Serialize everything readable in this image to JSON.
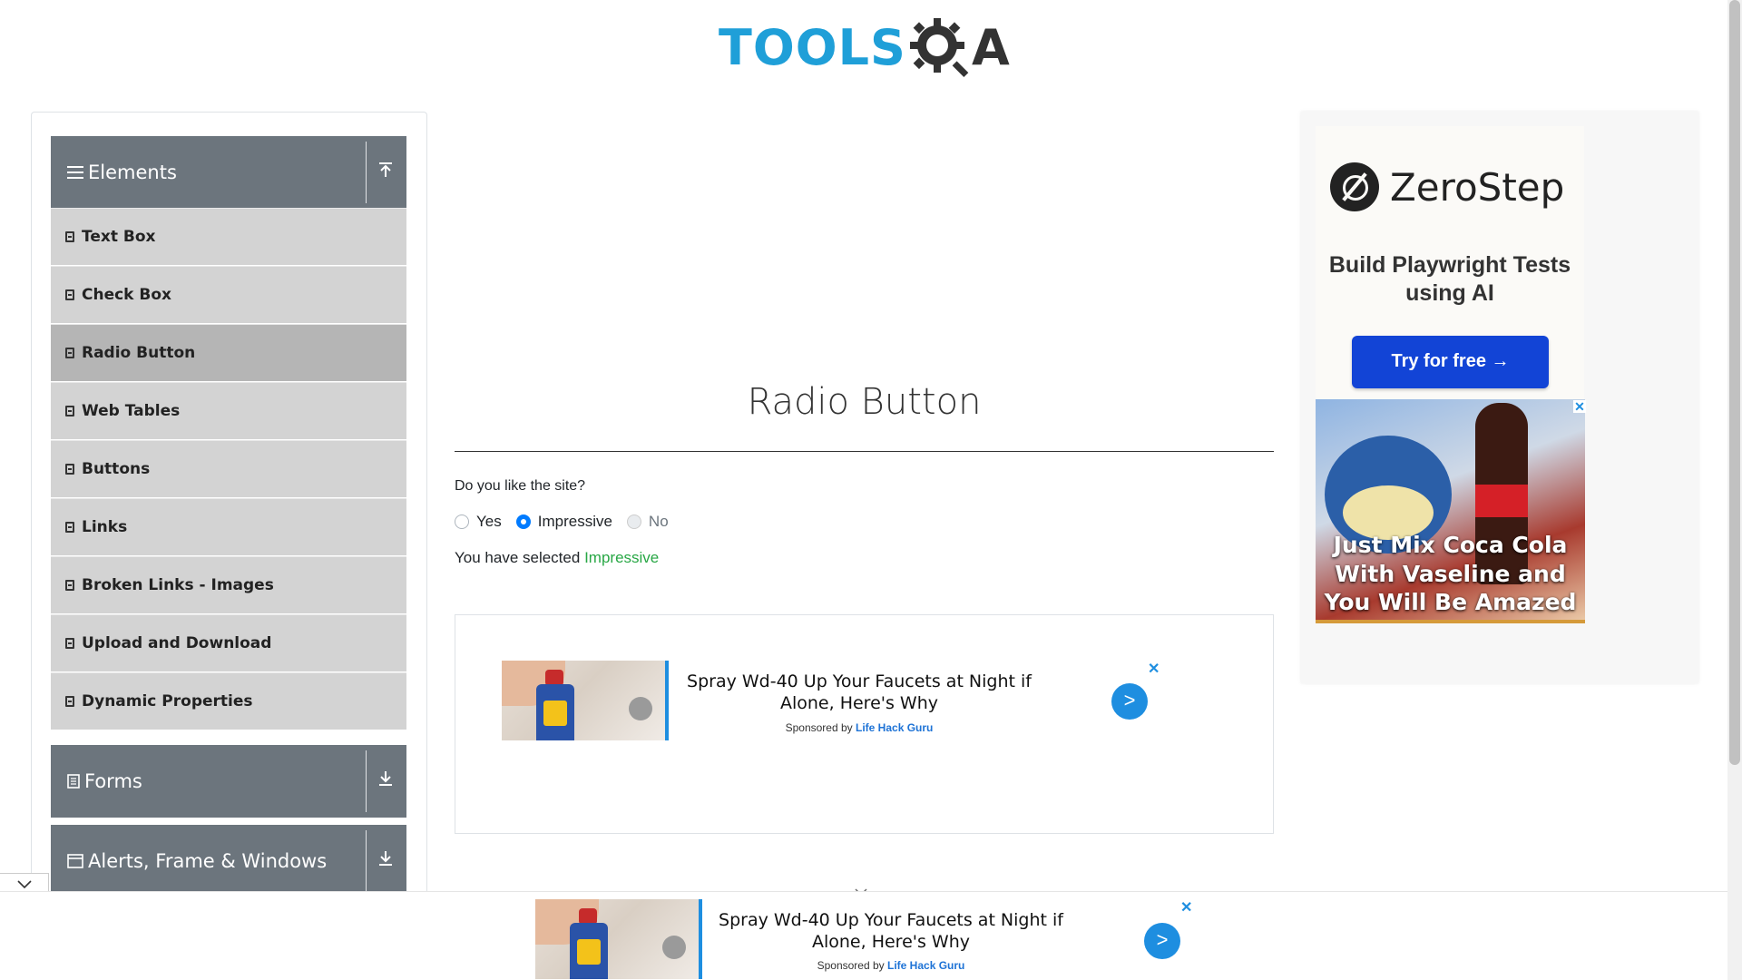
{
  "logo": {
    "left_text": "TOOLS",
    "right_text": "A"
  },
  "sidebar": {
    "groups": {
      "elements": "Elements",
      "forms": "Forms",
      "alerts": "Alerts, Frame & Windows"
    },
    "items": [
      {
        "label": "Text Box"
      },
      {
        "label": "Check Box"
      },
      {
        "label": "Radio Button",
        "active": true
      },
      {
        "label": "Web Tables"
      },
      {
        "label": "Buttons"
      },
      {
        "label": "Links"
      },
      {
        "label": "Broken Links - Images"
      },
      {
        "label": "Upload and Download"
      },
      {
        "label": "Dynamic Properties"
      }
    ]
  },
  "main": {
    "title": "Radio Button",
    "question": "Do you like the site?",
    "options": [
      {
        "label": "Yes",
        "checked": false,
        "disabled": false
      },
      {
        "label": "Impressive",
        "checked": true,
        "disabled": false
      },
      {
        "label": "No",
        "checked": false,
        "disabled": true
      }
    ],
    "selected_prefix": "You have selected",
    "selected_value": "Impressive"
  },
  "inline_ad": {
    "headline": "Spray Wd-40 Up Your Faucets at Night if Alone, Here's Why",
    "sponsor_prefix": "Sponsored by",
    "sponsor_name": "Life Hack Guru",
    "go_label": ">",
    "close_label": "✕"
  },
  "side_ad": {
    "brand": "ZeroStep",
    "tagline": "Build Playwright Tests using AI",
    "cta": "Try for free →",
    "second_ad_text": "Just Mix Coca Cola With Vaseline and You Will Be Amazed",
    "second_close": "✕"
  },
  "bottom_ad": {
    "headline": "Spray Wd-40 Up Your Faucets at Night if Alone, Here's Why",
    "sponsor_prefix": "Sponsored by",
    "sponsor_name": "Life Hack Guru",
    "go_label": ">",
    "close_label": "✕"
  },
  "colors": {
    "accent": "#1e8ee0",
    "sidebar_header": "#6c757d",
    "selected_value": "#28a745"
  }
}
